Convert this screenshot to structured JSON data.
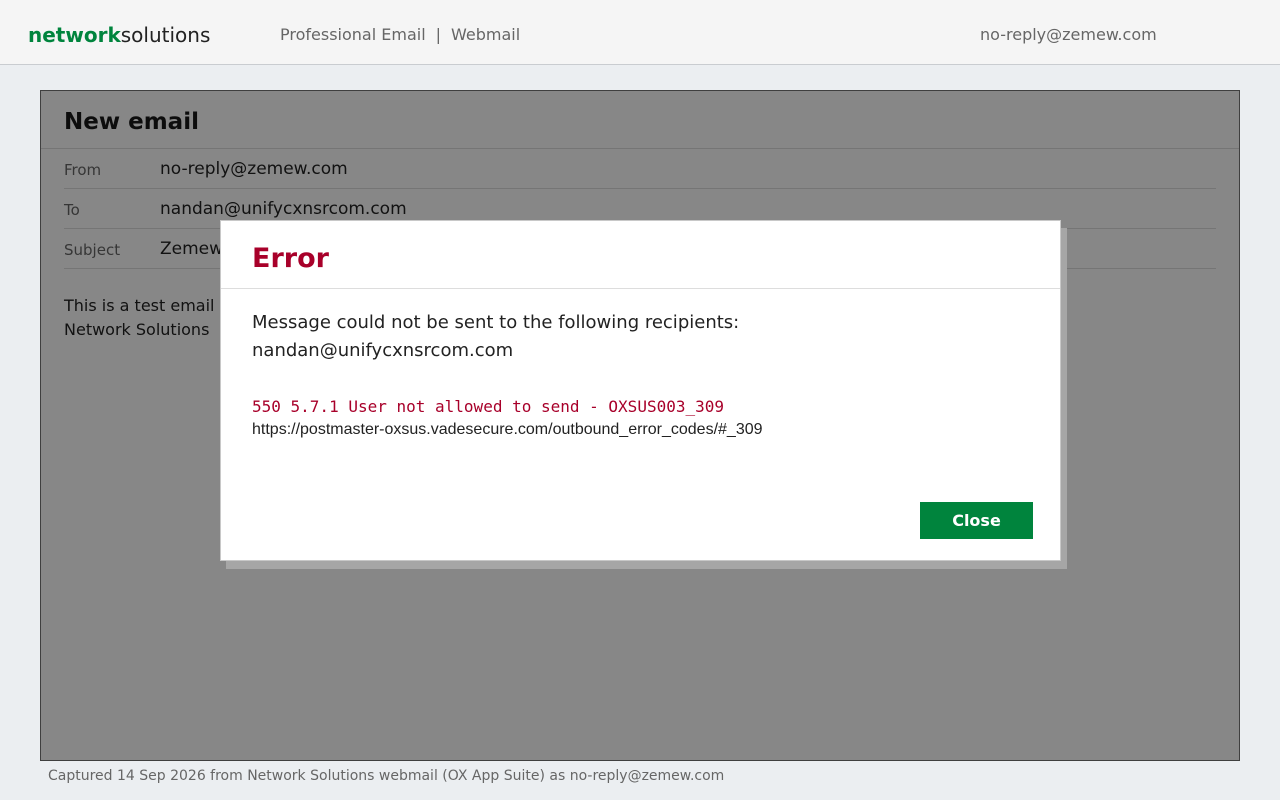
{
  "header": {
    "brand_part1": "network",
    "brand_part2": "solutions",
    "nav": [
      "Professional Email",
      "Webmail"
    ],
    "nav_separator": "|",
    "user": "no-reply@zemew.com"
  },
  "compose": {
    "title": "New email",
    "fields": [
      {
        "label": "From",
        "value": "no-reply@zemew.com"
      },
      {
        "label": "To",
        "value": "nandan@unifycxnsrcom.com"
      },
      {
        "label": "Subject",
        "value": "Zemew"
      }
    ],
    "body_lines": [
      "This is a test email",
      "Network Solutions"
    ]
  },
  "dialog": {
    "title": "Error",
    "message_line1": "Message could not be sent to the following recipients:",
    "message_line2": "nandan@unifycxnsrcom.com",
    "error_code": "550 5.7.1 User not allowed to send - OXSUS003_309",
    "error_url": "https://postmaster-oxsus.vadesecure.com/outbound_error_codes/#_309",
    "close_label": "Close"
  },
  "footer": {
    "caption": "Captured 14 Sep 2026 from Network Solutions webmail (OX App Suite) as no-reply@zemew.com"
  },
  "colors": {
    "brand_green": "#00843d",
    "error_red": "#a8002a"
  }
}
